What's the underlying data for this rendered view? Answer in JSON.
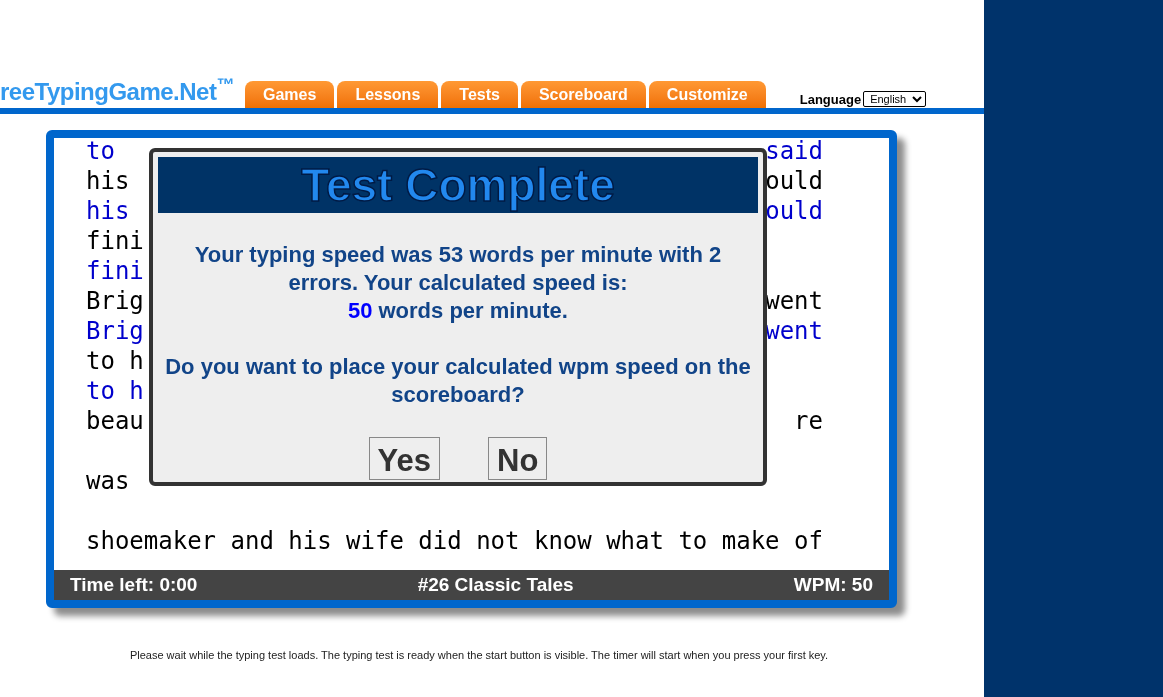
{
  "logo": "reeTypingGame.Net$^{™}$",
  "tabs": [
    {
      "label": "Games"
    },
    {
      "label": "Lessons"
    },
    {
      "label": "Tests"
    },
    {
      "label": "Scoreboard"
    },
    {
      "label": "Customize"
    }
  ],
  "language": {
    "label": "Language",
    "value": "English"
  },
  "text_lines": [
    {
      "kind": "typed",
      "left": "to",
      "right": "said"
    },
    {
      "kind": "source",
      "left": "his",
      "right": "ould"
    },
    {
      "kind": "typed",
      "left": "his",
      "right": "ould"
    },
    {
      "kind": "source",
      "left": "fini"
    },
    {
      "kind": "typed",
      "left": "fini"
    },
    {
      "kind": "source",
      "left": "Brig",
      "right": "went"
    },
    {
      "kind": "typed",
      "left": "Brig",
      "right": "went"
    },
    {
      "kind": "source",
      "left": "to h"
    },
    {
      "kind": "typed",
      "left": "to h"
    },
    {
      "kind": "source",
      "left": "beau",
      "right": "re"
    },
    {
      "kind": "blank"
    },
    {
      "kind": "source",
      "left": "was"
    },
    {
      "kind": "blank"
    },
    {
      "kind": "source",
      "left": "shoemaker and his wife did not know what to make of"
    }
  ],
  "dialog": {
    "title": "Test Complete",
    "message": "Your typing speed was 53 words per minute with 2 errors. Your calculated speed is:",
    "speed_value": "50",
    "speed_suffix": "words per minute.",
    "question": "Do you want to place your calculated wpm speed on the scoreboard?",
    "buttons": [
      "Yes",
      "No"
    ]
  },
  "status_bar": {
    "time_left": "Time left: 0:00",
    "test_name": "#26 Classic Tales",
    "wpm": "WPM: 50"
  },
  "footer": "Please wait while the typing test loads. The typing test is ready when the start button is visible. The timer will start when you press your first key."
}
